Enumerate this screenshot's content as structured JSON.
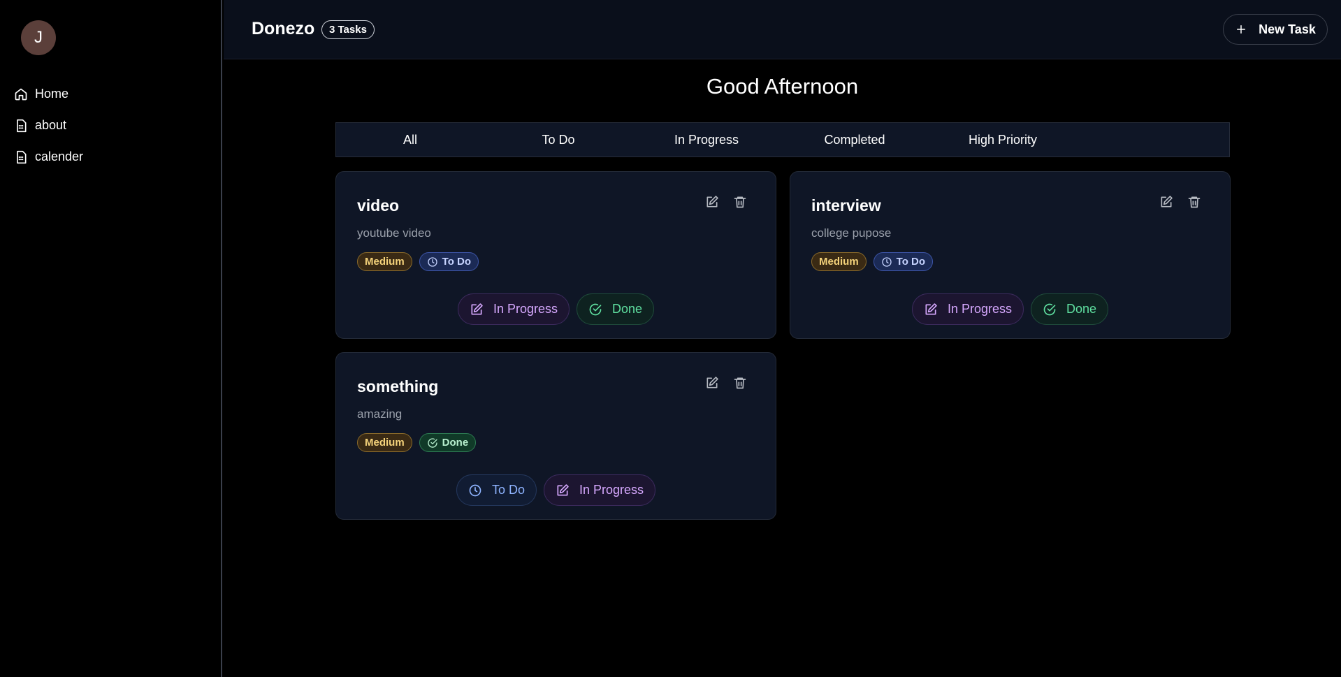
{
  "user": {
    "initial": "J"
  },
  "sidebar": {
    "items": [
      {
        "label": "Home",
        "icon": "home-icon"
      },
      {
        "label": "about",
        "icon": "file-icon"
      },
      {
        "label": "calender",
        "icon": "file-icon"
      }
    ]
  },
  "header": {
    "brand": "Donezo",
    "task_count": "3 Tasks",
    "new_task_label": "New Task"
  },
  "greeting": "Good Afternoon",
  "tabs": [
    "All",
    "To Do",
    "In Progress",
    "Completed",
    "High Priority"
  ],
  "tasks": [
    {
      "title": "video",
      "description": "youtube video",
      "priority": "Medium",
      "status": "To Do",
      "actions": [
        "In Progress",
        "Done"
      ]
    },
    {
      "title": "interview",
      "description": "college pupose",
      "priority": "Medium",
      "status": "To Do",
      "actions": [
        "In Progress",
        "Done"
      ]
    },
    {
      "title": "something",
      "description": "amazing",
      "priority": "Medium",
      "status": "Done",
      "actions": [
        "To Do",
        "In Progress"
      ]
    }
  ],
  "colors": {
    "background": "#000000",
    "panel": "#0f1626",
    "medium_badge": "#f4d27a",
    "todo_badge": "#c7d4ff",
    "done_badge": "#b8f0cf",
    "progress_action": "#d7a9ff",
    "done_action": "#5fe0a0",
    "todo_action": "#8fb4ff"
  }
}
